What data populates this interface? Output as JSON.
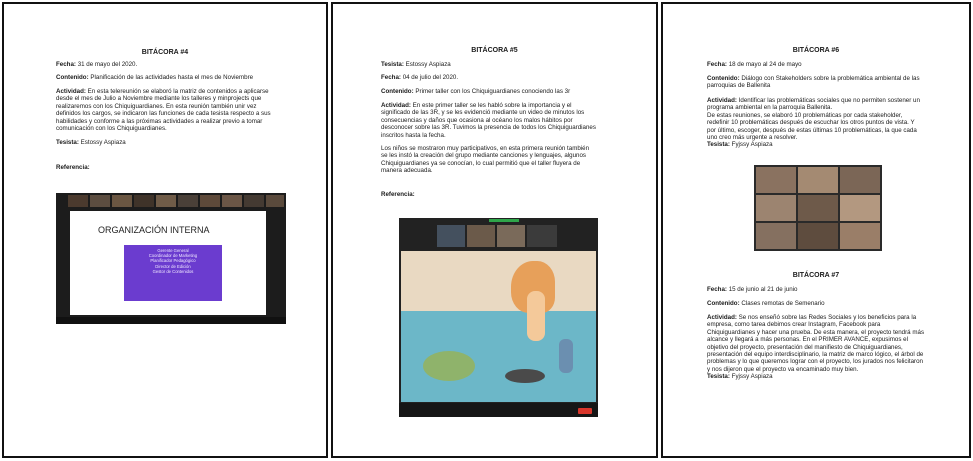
{
  "pages": [
    {
      "title": "BITÁCORA #4",
      "fecha_label": "Fecha:",
      "fecha": "31 de mayo del 2020.",
      "contenido_label": "Contenido:",
      "contenido": "Planificación de las actividades hasta el mes de Noviembre",
      "actividad_label": "Actividad:",
      "actividad": [
        "En esta telereunión se elaboró la matriz de contenidos a aplicarse",
        "desde el mes de Julio a Noviembre mediante los talleres y minprojects que",
        "realizaremos con los Chiquiguardianes. En esta reunión también unir vez",
        "definidos los cargos, se indicaron las funciones de cada tesista respecto a sus",
        "habilidades y conforme a las próximas actividades a realizar previo a tomar",
        "comunicación con los Chiquiguardianes."
      ],
      "tesista_label": "Tesista:",
      "tesista": "Estossy Aspiaza",
      "referencia_label": "Referencia:",
      "slide_title": "ORGANIZACIÓN INTERNA",
      "slide_lines": [
        "Gerente General",
        "Coordinador de Marketing",
        "Planificador Pedagógico",
        "Director de Edición",
        "Gestor de Contenidos"
      ]
    },
    {
      "title": "BITÁCORA #5",
      "tesista_label": "Tesista:",
      "tesista": "Estossy Aspiaza",
      "fecha_label": "Fecha:",
      "fecha": "04 de julio del 2020.",
      "contenido_label": "Contenido:",
      "contenido": "Primer taller con los Chiquiguardianes conociendo las 3r",
      "actividad_label": "Actividad:",
      "actividad": [
        "En este primer taller se les habló sobre la importancia y el",
        "significado de las 3R, y se les evidenció mediante un video de minutos los",
        "consecuencias y daños que ocasiona al océano los malos hábitos por",
        "desconocer sobre las 3R. Tuvimos la presencia de todos los Chiquiguardianes",
        "inscritos hasta la fecha."
      ],
      "parrafo2": [
        "Los niños se mostraron muy participativos, en esta primera reunión también",
        "se les instó la creación del grupo mediante canciones y lenguajes, algunos",
        "Chiquiguardianes ya se conocían, lo cual permitió que el taller fluyera de",
        "manera adecuada."
      ],
      "referencia_label": "Referencia:"
    },
    {
      "title": "BITÁCORA #6",
      "fecha_label": "Fecha:",
      "fecha": "18 de mayo al 24 de mayo",
      "contenido_label": "Contenido:",
      "contenido": [
        "Diálogo con Stakeholders sobre la problemática ambiental de las",
        "parroquias de Ballenita"
      ],
      "actividad_label": "Actividad:",
      "actividad": [
        "Identificar las problemáticas sociales que no permiten sostener un",
        "programa ambiental en la parroquia Ballenita.",
        "De estas reuniones, se elaboró 10 problemáticas por cada stakeholder,",
        "redefinir 10 problemáticas después de escuchar los otros puntos de vista. Y",
        "por último, escoger, después de estas últimas 10 problemáticas, la que cada",
        "uno creo más urgente a resolver."
      ],
      "tesista_label": "Tesista:",
      "tesista": "Fyjssy Aspiaza",
      "title2": "BITÁCORA #7",
      "fecha2": "15 de junio al 21 de junio",
      "contenido2": "Clases remotas de Semenario",
      "actividad2": [
        "Se nos enseñó sobre las Redes Sociales y los beneficios para la",
        "empresa, como tarea debimos crear Instagram, Facebook para",
        "Chiquiguardianes y hacer una prueba. De esta manera, el proyecto tendrá más",
        "alcance y llegará a más personas. En el PRIMER AVANCE, expusimos el",
        "objetivo del proyecto, presentación del manifiesto de Chiquiguardianes,",
        "presentación del equipo interdisciplinario, la matriz de marco lógico, el árbol de",
        "problemas y lo que queremos lograr con el proyecto, los jurados nos felicitaron",
        "y nos dijeron que el proyecto va encaminado muy bien."
      ],
      "tesista2": "Fyjssy Aspiaza"
    }
  ]
}
